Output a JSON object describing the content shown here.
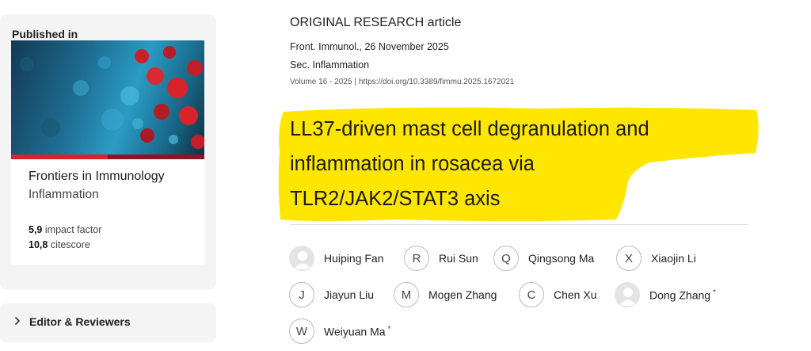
{
  "sidebar": {
    "published_in": "Published in",
    "journal_name": "Frontiers in Immunology",
    "journal_section": "Inflammation",
    "impact_factor_value": "5,9",
    "impact_factor_label": "impact factor",
    "citescore_value": "10,8",
    "citescore_label": "citescore",
    "editor_label": "Editor & Reviewers"
  },
  "article": {
    "type_label": "ORIGINAL RESEARCH article",
    "journal_date": "Front. Immunol., 26 November 2025",
    "section": "Sec. Inflammation",
    "volume": "Volume 16 - 2025",
    "separator": "|",
    "doi": "https://doi.org/10.3389/fimmu.2025.1672021",
    "title_lines": [
      "LL37-driven mast cell degranulation and",
      "inflammation in rosacea via",
      "TLR2/JAK2/STAT3 axis"
    ]
  },
  "authors": [
    {
      "name": "Huiping Fan",
      "initial": "",
      "photo": true,
      "corresponding": false
    },
    {
      "name": "Rui Sun",
      "initial": "R",
      "photo": false,
      "corresponding": false
    },
    {
      "name": "Qingsong Ma",
      "initial": "Q",
      "photo": false,
      "corresponding": false
    },
    {
      "name": "Xiaojin Li",
      "initial": "X",
      "photo": false,
      "corresponding": false
    },
    {
      "name": "Jiayun Liu",
      "initial": "J",
      "photo": false,
      "corresponding": false
    },
    {
      "name": "Mogen Zhang",
      "initial": "M",
      "photo": false,
      "corresponding": false
    },
    {
      "name": "Chen Xu",
      "initial": "C",
      "photo": false,
      "corresponding": false
    },
    {
      "name": "Dong Zhang",
      "initial": "",
      "photo": true,
      "corresponding": true
    },
    {
      "name": "Weiyuan Ma",
      "initial": "W",
      "photo": false,
      "corresponding": true
    }
  ],
  "corresponding_mark": "*",
  "colors": {
    "highlight": "#ffe600",
    "stripe_red": "#d8232a",
    "stripe_dark": "#8c1328",
    "card_bg": "#f4f4f4"
  },
  "icons": {
    "editor_toggle": "chevron-right-icon",
    "avatar_placeholder": "user-silhouette-icon"
  }
}
